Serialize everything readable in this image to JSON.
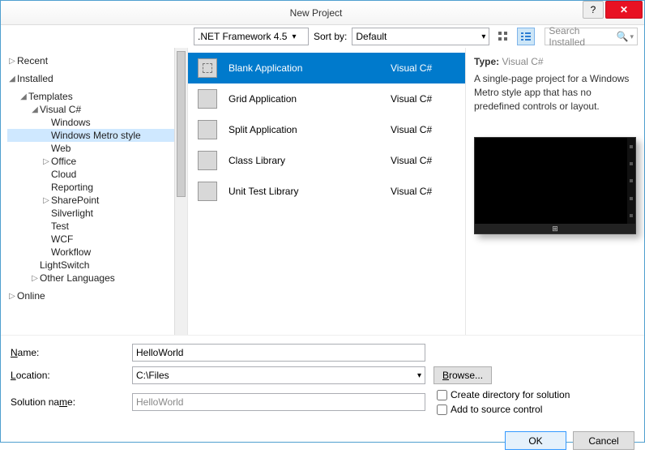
{
  "window": {
    "title": "New Project"
  },
  "toolbar": {
    "framework_label": ".NET Framework 4.5",
    "sortby_label": "Sort by:",
    "sortby_value": "Default",
    "search_placeholder": "Search Installed"
  },
  "tree": {
    "recent": "Recent",
    "installed": "Installed",
    "templates": "Templates",
    "visual_csharp": "Visual C#",
    "items": [
      "Windows",
      "Windows Metro style",
      "Web",
      "Office",
      "Cloud",
      "Reporting",
      "SharePoint",
      "Silverlight",
      "Test",
      "WCF",
      "Workflow"
    ],
    "lightswitch": "LightSwitch",
    "other_languages": "Other Languages",
    "online": "Online"
  },
  "templates": [
    {
      "name": "Blank Application",
      "lang": "Visual C#",
      "selected": true
    },
    {
      "name": "Grid Application",
      "lang": "Visual C#"
    },
    {
      "name": "Split Application",
      "lang": "Visual C#"
    },
    {
      "name": "Class Library",
      "lang": "Visual C#"
    },
    {
      "name": "Unit Test Library",
      "lang": "Visual C#"
    }
  ],
  "detail": {
    "type_label": "Type:",
    "type_value": "Visual C#",
    "description": "A single-page project for a Windows Metro style app that has no predefined controls or layout."
  },
  "form": {
    "name_label": "Name:",
    "name_value": "HelloWorld",
    "location_label": "Location:",
    "location_value": "C:\\Files",
    "solution_label": "Solution name:",
    "solution_value": "HelloWorld",
    "browse_label": "Browse...",
    "create_dir_label": "Create directory for solution",
    "add_source_label": "Add to source control"
  },
  "buttons": {
    "ok": "OK",
    "cancel": "Cancel"
  }
}
